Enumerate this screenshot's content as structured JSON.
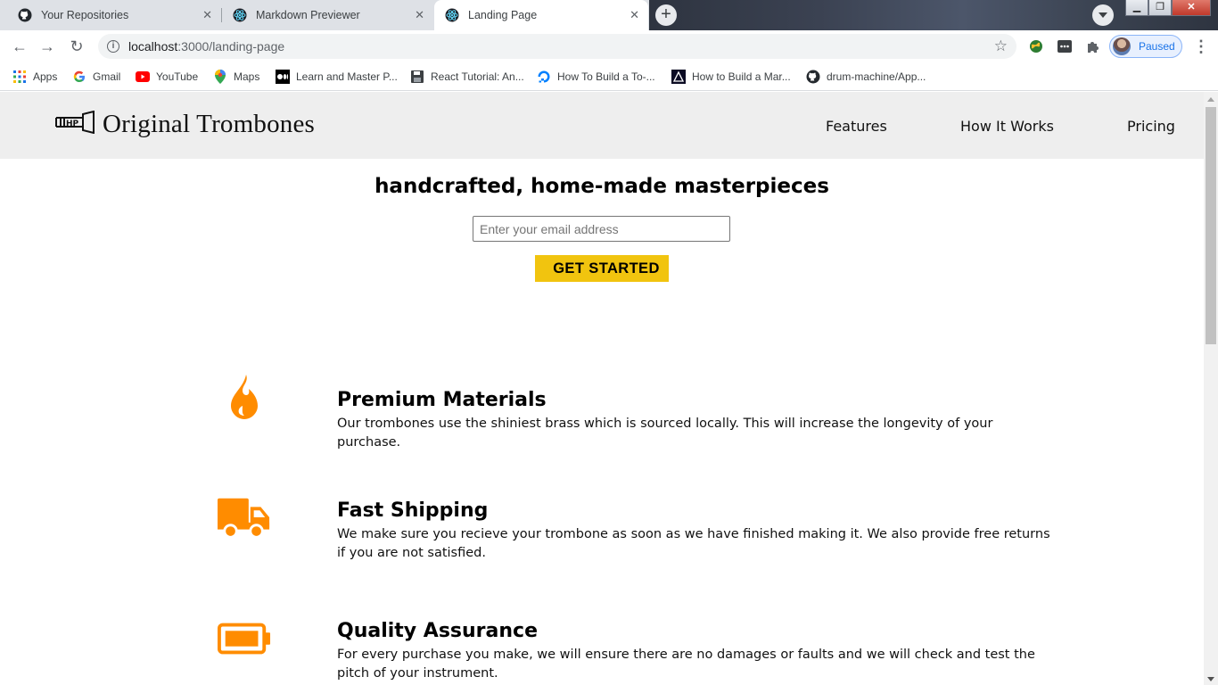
{
  "browser": {
    "tabs": [
      {
        "title": "Your Repositories",
        "icon": "github-icon",
        "active": false
      },
      {
        "title": "Markdown Previewer",
        "icon": "react-icon",
        "active": false
      },
      {
        "title": "Landing Page",
        "icon": "react-icon",
        "active": true
      }
    ],
    "new_tab_label": "+",
    "url": {
      "host": "localhost",
      "path": ":3000/landing-page"
    },
    "profile_status": "Paused",
    "bookmarks": [
      {
        "label": "Apps",
        "icon": "apps-grid-icon"
      },
      {
        "label": "Gmail",
        "icon": "google-icon"
      },
      {
        "label": "YouTube",
        "icon": "youtube-icon"
      },
      {
        "label": "Maps",
        "icon": "maps-pin-icon"
      },
      {
        "label": "Learn and Master P...",
        "icon": "medium-icon"
      },
      {
        "label": "React Tutorial: An...",
        "icon": "floppy-icon"
      },
      {
        "label": "How To Build a To-...",
        "icon": "digitalocean-icon"
      },
      {
        "label": "How to Build a Mar...",
        "icon": "triangle-logo-icon"
      },
      {
        "label": "drum-machine/App...",
        "icon": "github-icon"
      }
    ]
  },
  "site": {
    "brand": "Original Trombones",
    "nav": [
      "Features",
      "How It Works",
      "Pricing"
    ],
    "hero": {
      "title": "handcrafted, home-made masterpieces",
      "email_placeholder": "Enter your email address",
      "cta_label": "GET STARTED"
    },
    "features": [
      {
        "icon": "fire-icon",
        "title": "Premium Materials",
        "text": "Our trombones use the shiniest brass which is sourced locally. This will increase the longevity of your purchase."
      },
      {
        "icon": "truck-icon",
        "title": "Fast Shipping",
        "text": "We make sure you recieve your trombone as soon as we have finished making it. We also provide free returns if you are not satisfied."
      },
      {
        "icon": "battery-full-icon",
        "title": "Quality Assurance",
        "text": "For every purchase you make, we will ensure there are no damages or faults and we will check and test the pitch of your instrument."
      }
    ],
    "accent_color": "#ff8c00",
    "cta_color": "#f1c40f",
    "header_bg": "#eeeeee"
  }
}
